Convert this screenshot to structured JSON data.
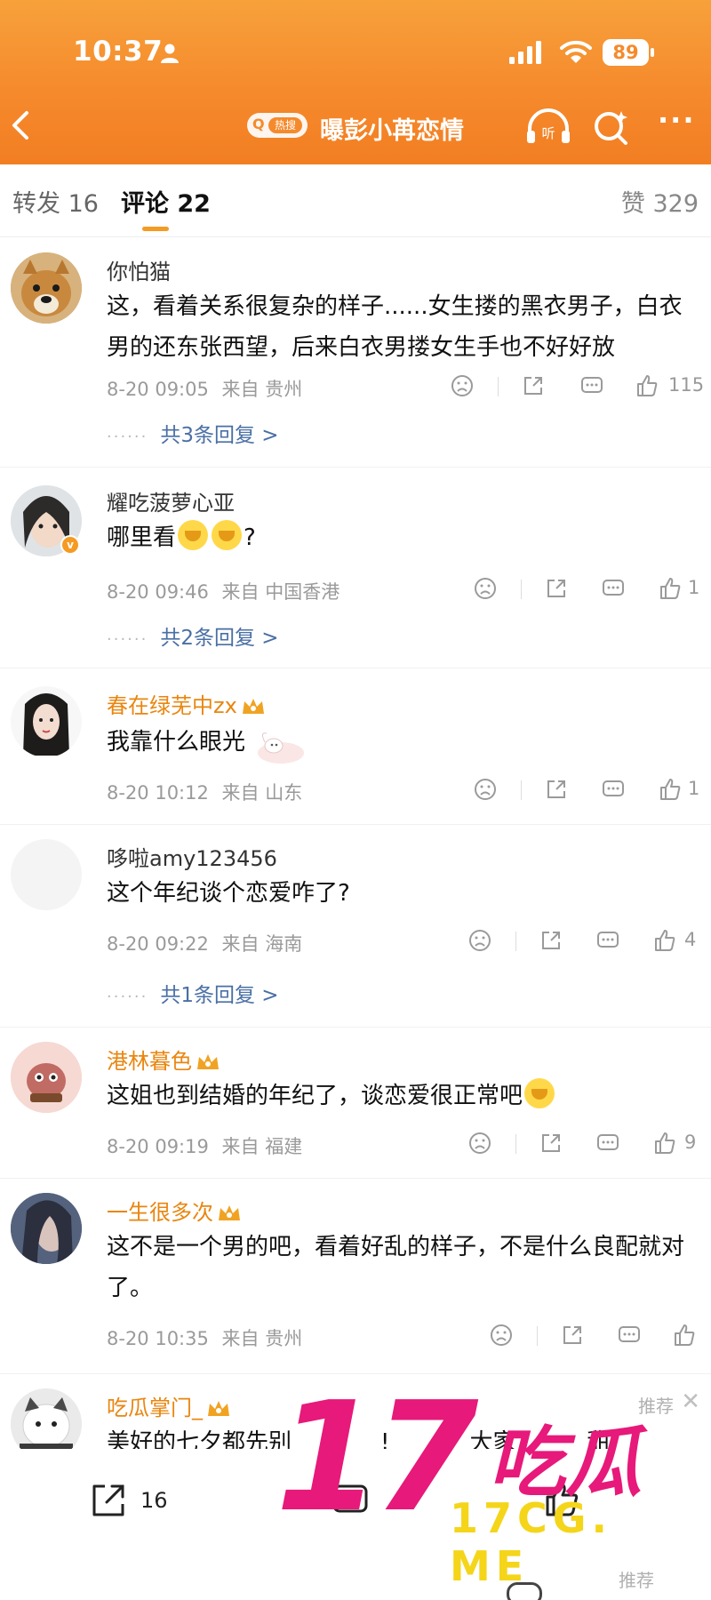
{
  "status_bar": {
    "time": "10:37",
    "battery": "89"
  },
  "nav": {
    "hot_tag": "热搜",
    "title": "曝彭小苒恋情",
    "listen": "听"
  },
  "tabs": {
    "repost": "转发 16",
    "comment": "评论 22",
    "like": "赞 329"
  },
  "comments": [
    {
      "user": "你怕猫",
      "text": "这，看着关系很复杂的样子......女生搂的黑衣男子，白衣男的还东张西望，后来白衣男搂女生手也不好好放",
      "date": "8-20 09:05",
      "from": "来自 贵州",
      "likes": "115",
      "replies": "共3条回复 >"
    },
    {
      "user": "耀吃菠萝心亚",
      "text": "哪里看",
      "text_suffix": "?",
      "date": "8-20 09:46",
      "from": "来自 中国香港",
      "likes": "1",
      "replies": "共2条回复 >"
    },
    {
      "user": "春在绿芜中zx",
      "text": "我靠什么眼光",
      "date": "8-20 10:12",
      "from": "来自 山东",
      "likes": "1"
    },
    {
      "user": "哆啦amy123456",
      "text": "这个年纪谈个恋爱咋了?",
      "date": "8-20 09:22",
      "from": "来自 海南",
      "likes": "4",
      "replies": "共1条回复 >"
    },
    {
      "user": "港林暮色",
      "text": "这姐也到结婚的年纪了，谈恋爱很正常吧",
      "date": "8-20 09:19",
      "from": "来自 福建",
      "likes": "9"
    },
    {
      "user": "一生很多次",
      "text": "这不是一个男的吧，看着好乱的样子，不是什么良配就对了。",
      "date": "8-20 10:35",
      "from": "来自 贵州",
      "likes": ""
    },
    {
      "user": "吃瓜掌门_",
      "text": "美好的七夕都先别",
      "text_b": "!",
      "text_c": "大家",
      "text_d": "甜",
      "text_e": "情"
    }
  ],
  "recommend": "推荐",
  "bottom_bar": {
    "share_count": "16",
    "recommend": "推荐"
  },
  "watermark": {
    "big": "17",
    "cn": "吃瓜",
    "url": "17CG. ME"
  },
  "colors": {
    "orange": "#f58a2c",
    "gold_name": "#e9860f",
    "reply_link": "#4a6fa5",
    "watermark_pink": "#e7197a",
    "watermark_yellow": "#f4d51a"
  }
}
